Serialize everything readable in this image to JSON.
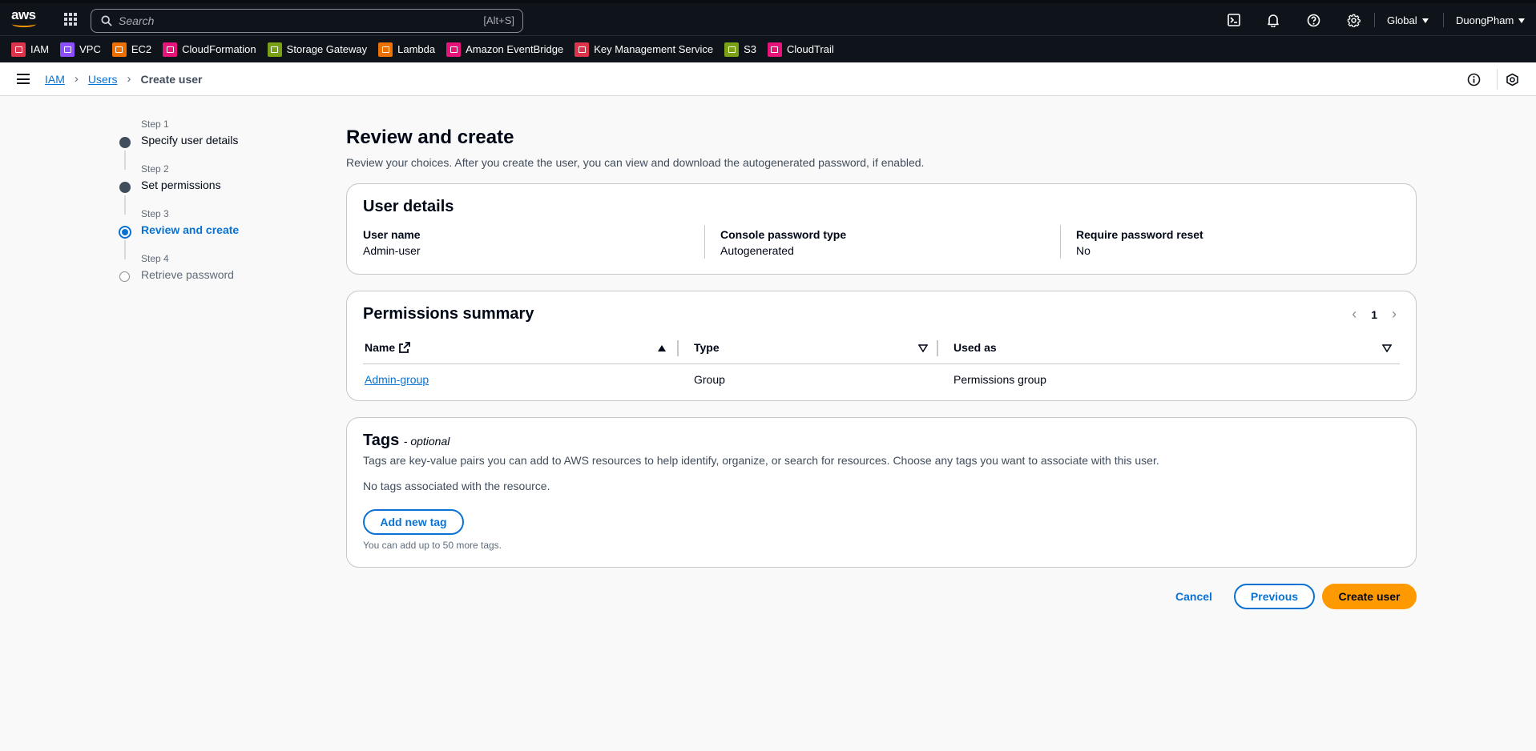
{
  "topbar": {
    "logo_text": "aws",
    "search_placeholder": "Search",
    "search_shortcut": "[Alt+S]",
    "region": "Global",
    "user": "DuongPham",
    "icons": [
      "cloudshell-icon",
      "bell-icon",
      "help-icon",
      "gear-icon"
    ]
  },
  "favorites": [
    {
      "label": "IAM",
      "color": "#dd344c"
    },
    {
      "label": "VPC",
      "color": "#8c4fff"
    },
    {
      "label": "EC2",
      "color": "#ed7100"
    },
    {
      "label": "CloudFormation",
      "color": "#e7157b"
    },
    {
      "label": "Storage Gateway",
      "color": "#7aa116"
    },
    {
      "label": "Lambda",
      "color": "#ed7100"
    },
    {
      "label": "Amazon EventBridge",
      "color": "#e7157b"
    },
    {
      "label": "Key Management Service",
      "color": "#dd344c"
    },
    {
      "label": "S3",
      "color": "#7aa116"
    },
    {
      "label": "CloudTrail",
      "color": "#e7157b"
    }
  ],
  "breadcrumb": {
    "items": [
      "IAM",
      "Users"
    ],
    "current": "Create user"
  },
  "steps": [
    {
      "label": "Step 1",
      "title": "Specify user details",
      "state": "done"
    },
    {
      "label": "Step 2",
      "title": "Set permissions",
      "state": "done"
    },
    {
      "label": "Step 3",
      "title": "Review and create",
      "state": "active"
    },
    {
      "label": "Step 4",
      "title": "Retrieve password",
      "state": "pending"
    }
  ],
  "page": {
    "title": "Review and create",
    "description": "Review your choices. After you create the user, you can view and download the autogenerated password, if enabled."
  },
  "user_details": {
    "title": "User details",
    "fields": [
      {
        "key": "User name",
        "value": "Admin-user"
      },
      {
        "key": "Console password type",
        "value": "Autogenerated"
      },
      {
        "key": "Require password reset",
        "value": "No"
      }
    ]
  },
  "permissions": {
    "title": "Permissions summary",
    "page": "1",
    "columns": [
      "Name",
      "Type",
      "Used as"
    ],
    "rows": [
      {
        "name": "Admin-group",
        "type": "Group",
        "used_as": "Permissions group"
      }
    ]
  },
  "tags": {
    "title": "Tags",
    "optional": "- optional",
    "description": "Tags are key-value pairs you can add to AWS resources to help identify, organize, or search for resources. Choose any tags you want to associate with this user.",
    "empty": "No tags associated with the resource.",
    "add_button": "Add new tag",
    "hint": "You can add up to 50 more tags."
  },
  "actions": {
    "cancel": "Cancel",
    "previous": "Previous",
    "create": "Create user"
  }
}
